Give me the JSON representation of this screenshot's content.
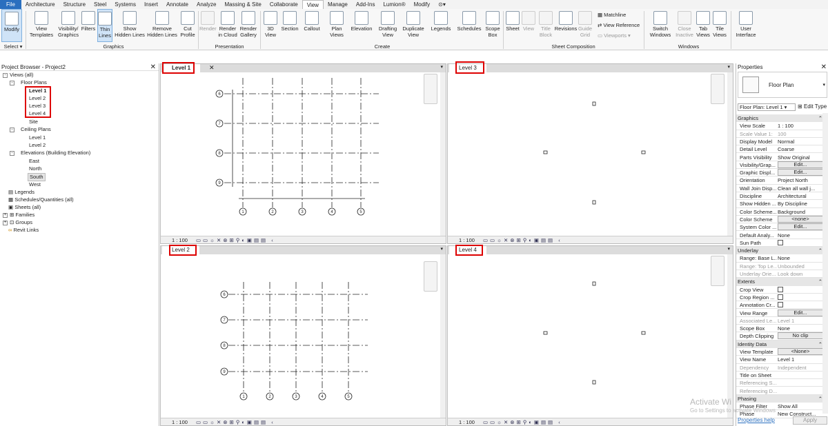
{
  "menu": [
    "File",
    "Architecture",
    "Structure",
    "Steel",
    "Systems",
    "Insert",
    "Annotate",
    "Analyze",
    "Massing & Site",
    "Collaborate",
    "View",
    "Manage",
    "Add-Ins",
    "Lumion®",
    "Modify"
  ],
  "ribbon": {
    "modify": "Modify",
    "select": "Select ▾",
    "view_templates": [
      "View",
      "Templates"
    ],
    "visibility": [
      "Visibility/",
      "Graphics"
    ],
    "filters": "Filters",
    "thin_lines": [
      "Thin",
      "Lines"
    ],
    "show_hidden": [
      "Show",
      "Hidden Lines"
    ],
    "remove_hidden": [
      "Remove",
      "Hidden Lines"
    ],
    "cut_profile": [
      "Cut",
      "Profile"
    ],
    "graphics": "Graphics",
    "render": "Render",
    "render_cloud": [
      "Render",
      "in Cloud"
    ],
    "render_gallery": [
      "Render",
      "Gallery"
    ],
    "presentation": "Presentation",
    "view3d": [
      "3D",
      "View"
    ],
    "section": "Section",
    "callout": "Callout",
    "plan_views": [
      "Plan",
      "Views"
    ],
    "elevation": "Elevation",
    "drafting": [
      "Drafting",
      "View"
    ],
    "duplicate": [
      "Duplicate",
      "View"
    ],
    "legends": "Legends",
    "schedules": "Schedules",
    "scope_box": [
      "Scope",
      "Box"
    ],
    "create": "Create",
    "sheet": "Sheet",
    "view_btn": "View",
    "title_block": [
      "Title",
      "Block"
    ],
    "revisions": "Revisions",
    "guide_grid": [
      "Guide",
      "Grid"
    ],
    "matchline": "Matchline",
    "view_reference": "View Reference",
    "viewports": "Viewports",
    "sheet_composition": "Sheet Composition",
    "switch_windows": [
      "Switch",
      "Windows"
    ],
    "close_inactive": [
      "Close",
      "Inactive"
    ],
    "tab_views": [
      "Tab",
      "Views"
    ],
    "tile_views": [
      "Tile",
      "Views"
    ],
    "windows": "Windows",
    "user_interface": [
      "User",
      "Interface"
    ]
  },
  "browser": {
    "title": "Project Browser - Project2",
    "views_all": "Views (all)",
    "floor_plans": "Floor Plans",
    "fp": [
      "Level 1",
      "Level 2",
      "Level 3",
      "Level 4",
      "Site"
    ],
    "ceiling_plans": "Ceiling Plans",
    "cp": [
      "Level 1",
      "Level 2"
    ],
    "elevations": "Elevations (Building Elevation)",
    "el": [
      "East",
      "North",
      "South",
      "West"
    ],
    "legends": "Legends",
    "schedules": "Schedules/Quantities (all)",
    "sheets": "Sheets (all)",
    "families": "Families",
    "groups": "Groups",
    "revit_links": "Revit Links"
  },
  "views": {
    "v1": "Level 1",
    "v2": "Level 2",
    "v3": "Level 3",
    "v4": "Level 4",
    "scale": "1 : 100"
  },
  "grids": {
    "horizontal": [
      "6",
      "7",
      "8",
      "9"
    ],
    "vertical": [
      "1",
      "2",
      "3",
      "4",
      "5"
    ]
  },
  "props": {
    "title": "Properties",
    "type": "Floor Plan",
    "selector": "Floor Plan: Level 1",
    "edit_type": "Edit Type",
    "sec_graphics": "Graphics",
    "graphics": [
      [
        "View Scale",
        "1 : 100",
        ""
      ],
      [
        "Scale Value   1:",
        "100",
        "dis"
      ],
      [
        "Display Model",
        "Normal",
        ""
      ],
      [
        "Detail Level",
        "Coarse",
        ""
      ],
      [
        "Parts Visibility",
        "Show Original",
        ""
      ],
      [
        "Visibility/Grap...",
        "Edit...",
        "btn"
      ],
      [
        "Graphic Displ...",
        "Edit...",
        "btn"
      ],
      [
        "Orientation",
        "Project North",
        ""
      ],
      [
        "Wall Join Disp...",
        "Clean all wall j...",
        ""
      ],
      [
        "Discipline",
        "Architectural",
        ""
      ],
      [
        "Show Hidden ...",
        "By Discipline",
        ""
      ],
      [
        "Color Scheme...",
        "Background",
        ""
      ],
      [
        "Color Scheme",
        "<none>",
        "btn"
      ],
      [
        "System Color ...",
        "Edit...",
        "btn"
      ],
      [
        "Default Analy...",
        "None",
        ""
      ],
      [
        "Sun Path",
        "",
        "cb"
      ]
    ],
    "sec_underlay": "Underlay",
    "underlay": [
      [
        "Range: Base L...",
        "None",
        ""
      ],
      [
        "Range: Top Le...",
        "Unbounded",
        "dis"
      ],
      [
        "Underlay Orie...",
        "Look down",
        "dis"
      ]
    ],
    "sec_extents": "Extents",
    "extents": [
      [
        "Crop View",
        "",
        "cb"
      ],
      [
        "Crop Region ...",
        "",
        "cb"
      ],
      [
        "Annotation Cr...",
        "",
        "cb"
      ],
      [
        "View Range",
        "Edit...",
        "btn"
      ],
      [
        "Associated Le...",
        "Level 1",
        "dis"
      ],
      [
        "Scope Box",
        "None",
        ""
      ],
      [
        "Depth Clipping",
        "No clip",
        "btn"
      ]
    ],
    "sec_identity": "Identity Data",
    "identity": [
      [
        "View Template",
        "<None>",
        "btn"
      ],
      [
        "View Name",
        "Level 1",
        ""
      ],
      [
        "Dependency",
        "Independent",
        "dis"
      ],
      [
        "Title on Sheet",
        "",
        ""
      ],
      [
        "Referencing S...",
        "",
        "dis"
      ],
      [
        "Referencing D...",
        "",
        "dis"
      ]
    ],
    "sec_phasing": "Phasing",
    "phasing": [
      [
        "Phase Filter",
        "Show All",
        ""
      ],
      [
        "Phase",
        "New Construct...",
        ""
      ]
    ],
    "help": "Properties help",
    "apply": "Apply",
    "watermark1": "Activate Wi",
    "watermark2": "Go to Settings to activate Windows"
  },
  "colors": {
    "accent": "#2a6fbf",
    "highlight": "#d00000"
  }
}
